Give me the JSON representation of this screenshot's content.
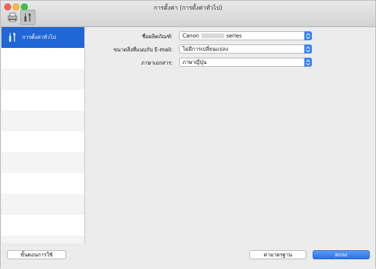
{
  "window": {
    "title": "การตั้งค่า (การตั้งค่าทั่วไป)"
  },
  "toolbar": {
    "items": [
      {
        "icon": "printer-icon",
        "active": false
      },
      {
        "icon": "tools-icon",
        "active": true
      }
    ]
  },
  "sidebar": {
    "items": [
      {
        "label": "การตั้งค่าทั่วไป",
        "icon": "tools-icon",
        "selected": true
      }
    ]
  },
  "form": {
    "product_name": {
      "label": "ชื่อผลิตภัณฑ์:",
      "value_prefix": "Canon",
      "value_suffix": "series"
    },
    "attachment_size": {
      "label": "ขนาดสิ่งที่แนบกับ E-mail:",
      "value": "ไม่มีการเปลี่ยนแปลง"
    },
    "document_language": {
      "label": "ภาษาเอกสาร:",
      "value": "ภาษาญี่ปุ่น"
    }
  },
  "footer": {
    "instructions_button": "ขั้นตอนการใช้",
    "defaults_button": "ค่ามาตรฐาน",
    "ok_button": "ตกลง"
  },
  "colors": {
    "accent": "#1f66d6",
    "button_primary": "#2a72ea"
  }
}
